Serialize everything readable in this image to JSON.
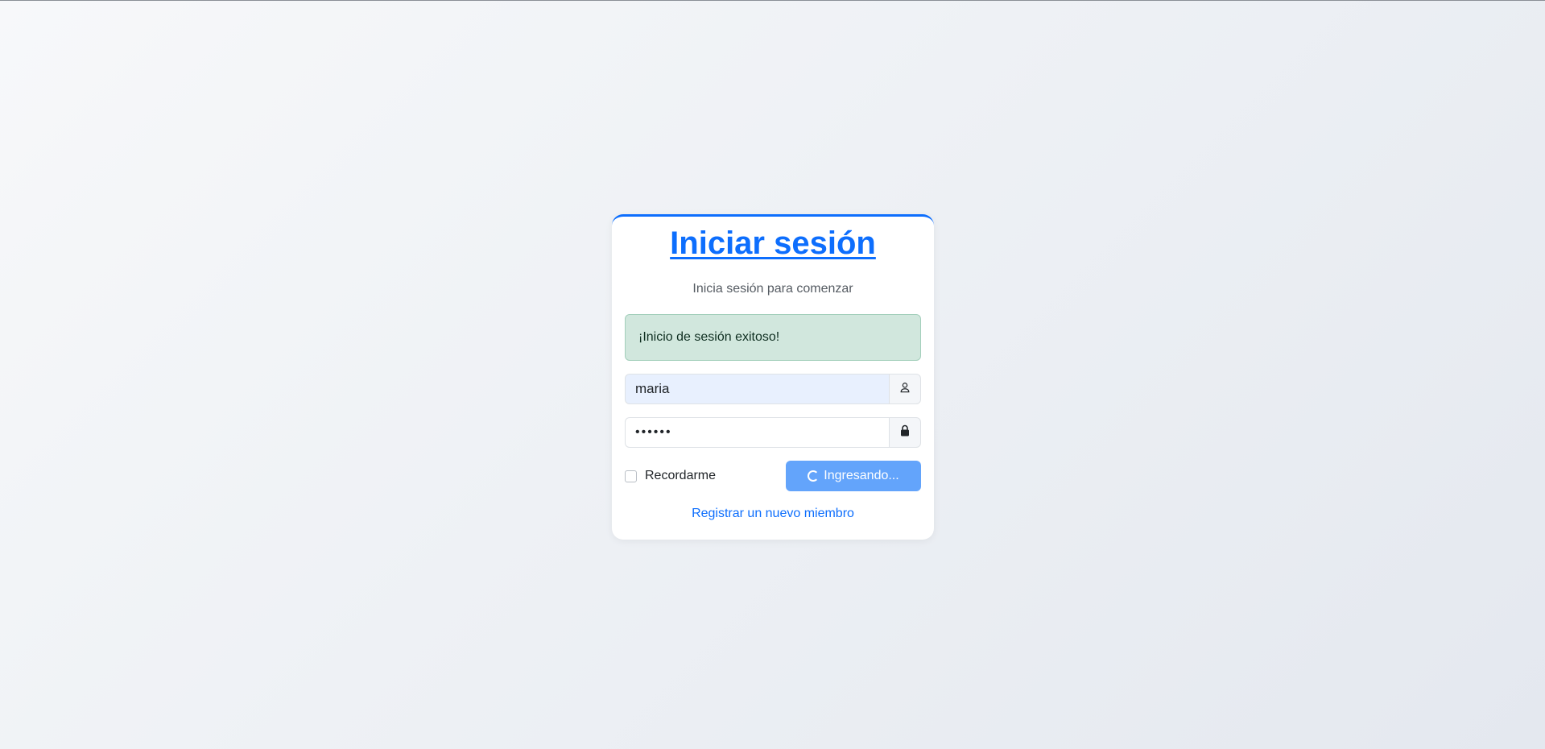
{
  "login": {
    "title": "Iniciar sesión",
    "subtitle": "Inicia sesión para comenzar",
    "alert": "¡Inicio de sesión exitoso!",
    "username_value": "maria",
    "password_value": "••••••",
    "remember_label": "Recordarme",
    "submit_label": "Ingresando...",
    "register_link": "Registrar un nuevo miembro"
  },
  "icons": {
    "username": "user-icon",
    "password": "lock-icon",
    "submit": "spinner-icon"
  },
  "colors": {
    "accent": "#0d6efd",
    "button": "#63a4fb",
    "alert_bg": "#d1e7dd",
    "alert_border": "#a3cfbb"
  }
}
